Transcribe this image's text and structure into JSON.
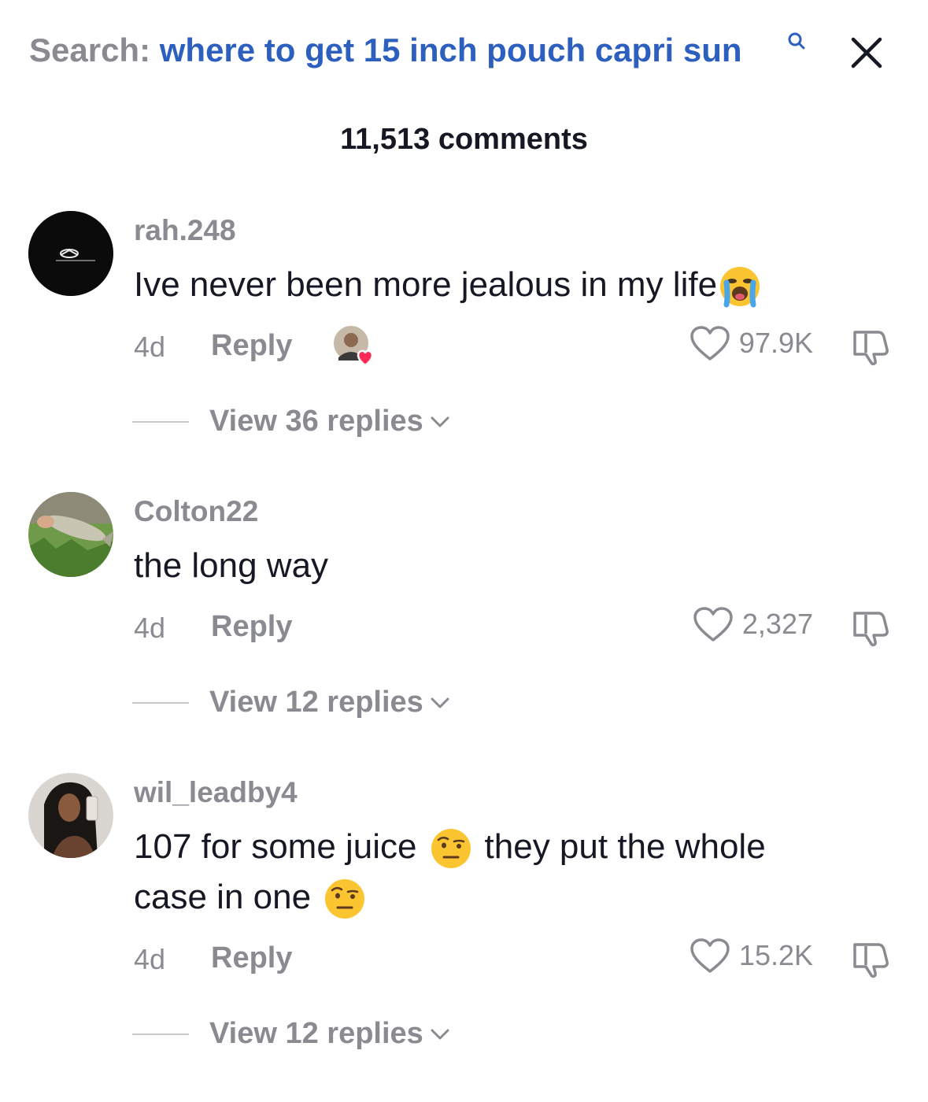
{
  "search": {
    "prefix": "Search:",
    "query": "where to get 15 inch pouch capri sun",
    "glass_icon": "search-icon",
    "close_icon": "close-icon"
  },
  "comment_count": "11,513 comments",
  "colors": {
    "query": "#2d5fbf",
    "muted": "#8a8b91",
    "text": "#161823",
    "heart": "#fe2c55"
  },
  "comments": [
    {
      "username": "rah.248",
      "text_before": "Ive never been more jealous in my life",
      "text_after": "",
      "text_line2": "",
      "emoji": "loudly-crying-face",
      "age": "4d",
      "reply": "Reply",
      "likes": "97.9K",
      "creator_liked": true,
      "view_replies": "View 36 replies"
    },
    {
      "username": "Colton22",
      "text_before": "the long way",
      "age": "4d",
      "reply": "Reply",
      "likes": "2,327",
      "creator_liked": false,
      "view_replies": "View 12 replies"
    },
    {
      "username": "wil_leadby4",
      "text_before": "107 for some juice",
      "text_after": "they put the whole",
      "text_line2": "case in one",
      "emoji": "face-with-raised-eyebrow",
      "age": "4d",
      "reply": "Reply",
      "likes": "15.2K",
      "creator_liked": false,
      "view_replies": "View 12 replies"
    }
  ]
}
